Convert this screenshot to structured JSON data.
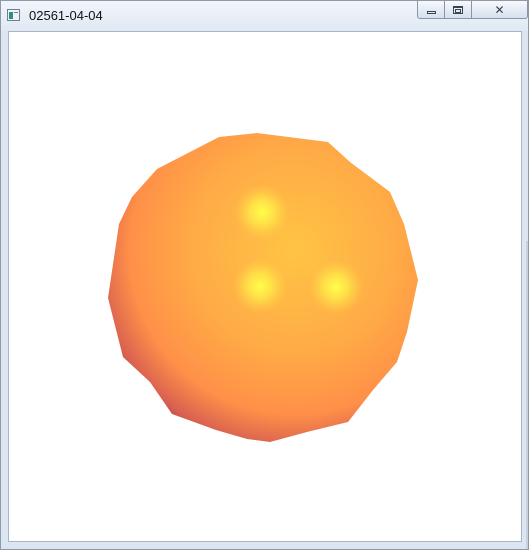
{
  "window": {
    "title": "02561-04-04",
    "controls": {
      "minimize": "minimize",
      "maximize": "maximize",
      "close": "close"
    },
    "icons": {
      "app": "app-window-icon",
      "minimize": "minimize-icon",
      "maximize": "maximize-icon",
      "close": "close-icon"
    }
  },
  "scene": {
    "object": "shaded-sphere",
    "colors": {
      "background": "#ffffff",
      "highlight": "#ffff4a",
      "light": "#ffc444",
      "mid": "#ff9a48",
      "shadow": "#b34a52",
      "dark": "#3a0d45"
    }
  }
}
